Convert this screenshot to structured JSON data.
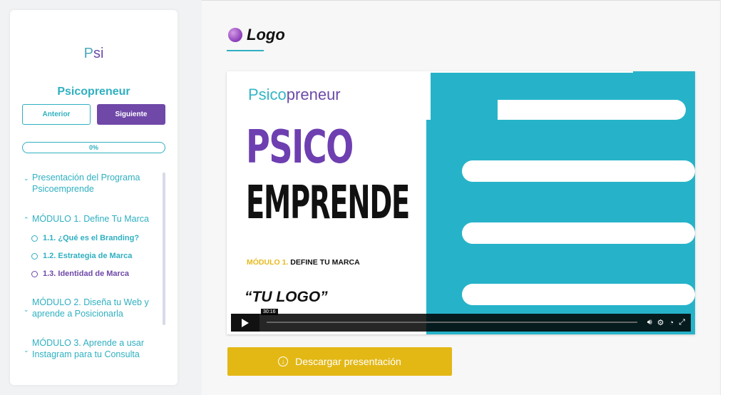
{
  "sidebar": {
    "brand": {
      "p": "P",
      "si": "si"
    },
    "course_title": "Psicopreneur",
    "prev_label": "Anterior",
    "next_label": "Siguiente",
    "progress": {
      "value": 0,
      "label": "0%"
    },
    "sections": [
      {
        "label": "Presentación del Programa Psicoemprende",
        "icon": "chevron-down-icon"
      },
      {
        "label": "MÓDULO 1. Define Tu Marca",
        "icon": "chevron-up-icon"
      },
      {
        "label": "MÓDULO 2. Diseña tu Web y aprende a Posicionarla",
        "icon": "chevron-down-icon"
      },
      {
        "label": "MÓDULO 3. Aprende a usar Instagram para tu Consulta",
        "icon": "chevron-down-icon"
      }
    ],
    "lessons": [
      {
        "label": "1.1. ¿Qué es el Branding?"
      },
      {
        "label": "1.2. Estrategia de Marca"
      },
      {
        "label": "1.3. Identidad de Marca"
      }
    ]
  },
  "main": {
    "lesson_title": "Logo",
    "lesson_icon": "purple-bubble-icon",
    "video": {
      "brand_pre": "Psico",
      "brand_post": "preneur",
      "big_line1": "PSICO",
      "big_line2": "EMPRENDE",
      "module_label": "MÓDULO 1.",
      "module_text": "DEFINE TU MARCA",
      "quote": "“TU LOGO”",
      "timestamp": "30:16"
    },
    "download_label": "Descargar presentación"
  },
  "colors": {
    "teal": "#2fb0c1",
    "purple": "#6f48a8",
    "yellow": "#e3b815"
  }
}
